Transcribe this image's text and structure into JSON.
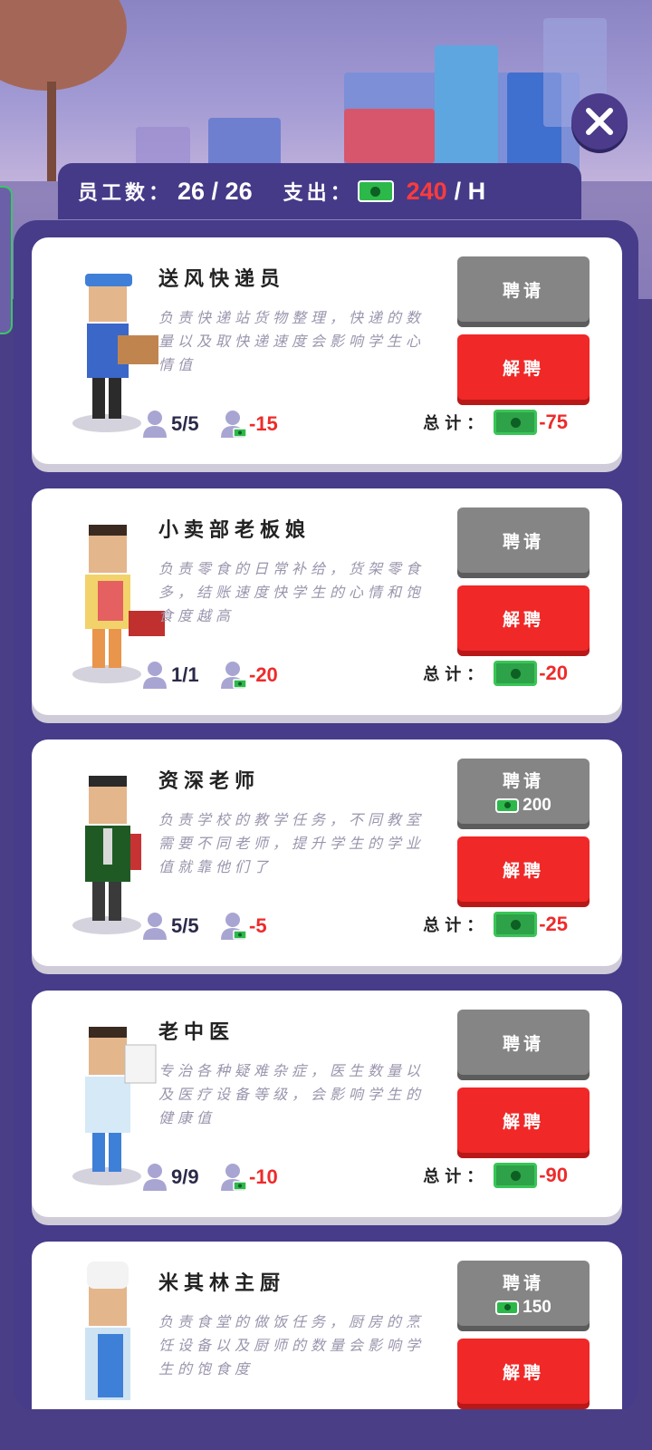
{
  "header": {
    "staff_label": "员工数：",
    "staff_value": "26 / 26",
    "expense_label": "支出：",
    "expense_value": "240",
    "expense_unit": "/ H"
  },
  "colors": {
    "panel": "#463c8a",
    "hire": "#858585",
    "fire": "#f02828",
    "negative": "#ee2b2b",
    "cash": "#2ea248"
  },
  "cards": [
    {
      "title": "送风快递员",
      "desc": "负责快递站货物整理，快递的数量以及取快递速度会影响学生心情值",
      "count": "5/5",
      "pay": "-15",
      "total_label": "总计：",
      "total": "-75",
      "hire_label": "聘请",
      "hire_cost": "",
      "fire_label": "解聘",
      "char": "delivery"
    },
    {
      "title": "小卖部老板娘",
      "desc": "负责零食的日常补给，货架零食多，结账速度快学生的心情和饱食度越高",
      "count": "1/1",
      "pay": "-20",
      "total_label": "总计：",
      "total": "-20",
      "hire_label": "聘请",
      "hire_cost": "",
      "fire_label": "解聘",
      "char": "shop"
    },
    {
      "title": "资深老师",
      "desc": "负责学校的教学任务，不同教室需要不同老师，提升学生的学业值就靠他们了",
      "count": "5/5",
      "pay": "-5",
      "total_label": "总计：",
      "total": "-25",
      "hire_label": "聘请",
      "hire_cost": "200",
      "fire_label": "解聘",
      "char": "teacher"
    },
    {
      "title": "老中医",
      "desc": "专治各种疑难杂症，医生数量以及医疗设备等级，会影响学生的健康值",
      "count": "9/9",
      "pay": "-10",
      "total_label": "总计：",
      "total": "-90",
      "hire_label": "聘请",
      "hire_cost": "",
      "fire_label": "解聘",
      "char": "doctor"
    },
    {
      "title": "米其林主厨",
      "desc": "负责食堂的做饭任务，厨房的烹饪设备以及厨师的数量会影响学生的饱食度",
      "count": "",
      "pay": "",
      "total_label": "",
      "total": "",
      "hire_label": "聘请",
      "hire_cost": "150",
      "fire_label": "解聘",
      "char": "chef"
    }
  ]
}
